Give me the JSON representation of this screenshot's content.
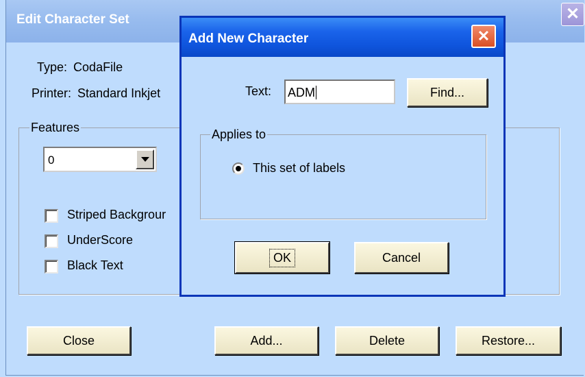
{
  "main_window": {
    "title": "Edit Character Set",
    "close_glyph": "✕",
    "type_label": "Type:",
    "type_value": "CodaFile",
    "printer_label": "Printer:",
    "printer_value": "Standard Inkjet",
    "features": {
      "legend": "Features",
      "selected": "0",
      "checkboxes": [
        {
          "label": "Striped Backgrour",
          "checked": false
        },
        {
          "label": "UnderScore",
          "checked": false
        },
        {
          "label": "Black Text",
          "checked": false
        }
      ]
    },
    "buttons": {
      "close": "Close",
      "add": "Add...",
      "delete": "Delete",
      "restore": "Restore..."
    }
  },
  "dialog": {
    "title": "Add New Character",
    "close_glyph": "✕",
    "text_label": "Text:",
    "text_value": "ADM",
    "find_button": "Find...",
    "applies_to": {
      "legend": "Applies to",
      "option_label": "This set of labels",
      "selected": true
    },
    "ok_button": "OK",
    "cancel_button": "Cancel"
  },
  "colors": {
    "window_background": "#bfdcfd",
    "active_title_blue": "#0f55dd",
    "inactive_title": "#97bbee",
    "close_button_red": "#d94f24",
    "button_face": "#f4efd2"
  },
  "icons": {
    "main_close": "close-icon",
    "dialog_close": "close-icon",
    "dropdown": "chevron-down-icon"
  }
}
